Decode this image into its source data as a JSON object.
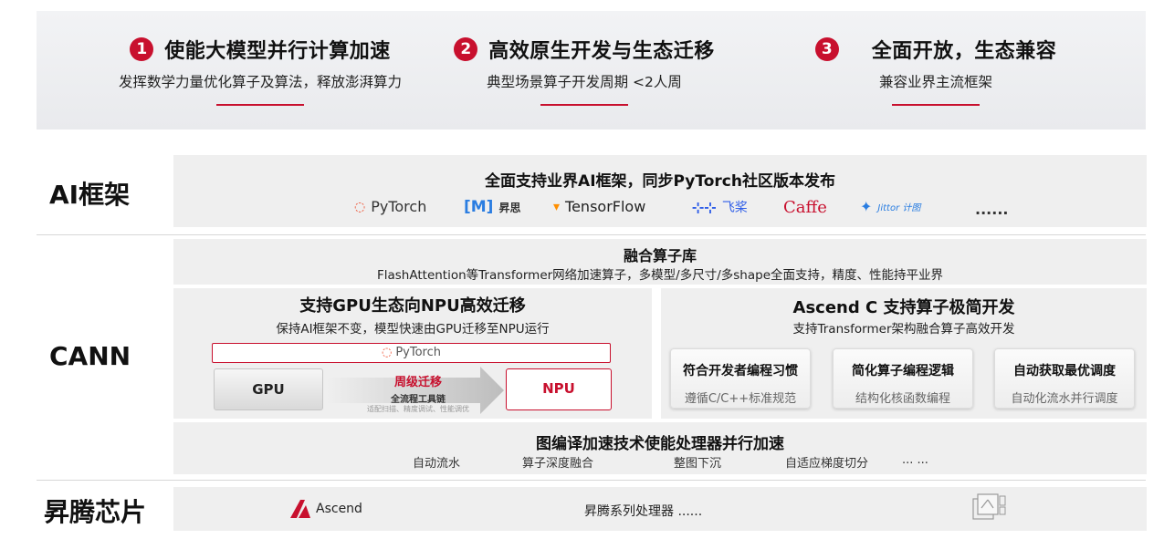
{
  "pillars": [
    {
      "num": "1",
      "title": "使能大模型并行计算加速",
      "subtitle": "发挥数学力量优化算子及算法，释放澎湃算力"
    },
    {
      "num": "2",
      "title": "高效原生开发与生态迁移",
      "subtitle": "典型场景算子开发周期 <2人周"
    },
    {
      "num": "3",
      "title": "全面开放，生态兼容",
      "subtitle": "兼容业界主流框架"
    }
  ],
  "rows": {
    "ai_framework": "AI框架",
    "cann": "CANN",
    "chip": "昇腾芯片"
  },
  "ai_framework": {
    "title": "全面支持业界AI框架，同步PyTorch社区版本发布",
    "frameworks": [
      "PyTorch",
      "[M]",
      "昇思",
      "TensorFlow",
      "飞桨",
      "Caffe",
      "Jittor 计图",
      "......"
    ]
  },
  "fusion_lib": {
    "title": "融合算子库",
    "desc": "FlashAttention等Transformer网络加速算子，多模型/多尺寸/多shape全面支持，精度、性能持平业界"
  },
  "gpu_migration": {
    "title": "支持GPU生态向NPU高效迁移",
    "desc": "保持AI框架不变，模型快速由GPU迁移至NPU运行",
    "framework": "PyTorch",
    "gpu": "GPU",
    "npu": "NPU",
    "cycle": "周级迁移",
    "toolchain": "全流程工具链",
    "tools": "适配扫描、精度调试、性能调优"
  },
  "ascend_c": {
    "title": "Ascend C 支持算子极简开发",
    "desc": "支持Transformer架构融合算子高效开发",
    "cards": [
      {
        "title": "符合开发者编程习惯",
        "desc": "遵循C/C++标准规范"
      },
      {
        "title": "简化算子编程逻辑",
        "desc": "结构化核函数编程"
      },
      {
        "title": "自动获取最优调度",
        "desc": "自动化流水并行调度"
      }
    ]
  },
  "graph_compile": {
    "title": "图编译加速技术使能处理器并行加速",
    "tags": [
      "自动流水",
      "算子深度融合",
      "整图下沉",
      "自适应梯度切分",
      "... ..."
    ]
  },
  "chip": {
    "brand": "Ascend",
    "desc": "昇腾系列处理器 ......"
  },
  "colors": {
    "accent": "#c8102e",
    "panel": "#efefef",
    "banner": "#eceef0"
  }
}
